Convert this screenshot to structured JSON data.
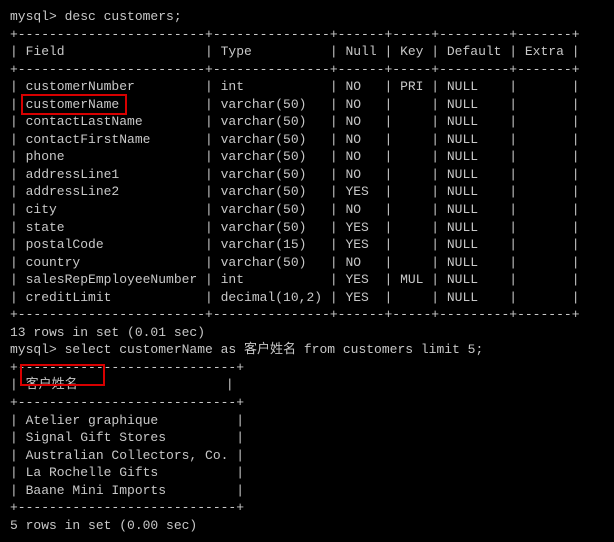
{
  "prompt1": "mysql> desc customers;",
  "tbl1": {
    "border_top": "+------------------------+---------------+------+-----+---------+-------+",
    "header": "| Field                  | Type          | Null | Key | Default | Extra |",
    "border_mid": "+------------------------+---------------+------+-----+---------+-------+",
    "rows": [
      "| customerNumber         | int           | NO   | PRI | NULL    |       |",
      "| customerName           | varchar(50)   | NO   |     | NULL    |       |",
      "| contactLastName        | varchar(50)   | NO   |     | NULL    |       |",
      "| contactFirstName       | varchar(50)   | NO   |     | NULL    |       |",
      "| phone                  | varchar(50)   | NO   |     | NULL    |       |",
      "| addressLine1           | varchar(50)   | NO   |     | NULL    |       |",
      "| addressLine2           | varchar(50)   | YES  |     | NULL    |       |",
      "| city                   | varchar(50)   | NO   |     | NULL    |       |",
      "| state                  | varchar(50)   | YES  |     | NULL    |       |",
      "| postalCode             | varchar(15)   | YES  |     | NULL    |       |",
      "| country                | varchar(50)   | NO   |     | NULL    |       |",
      "| salesRepEmployeeNumber | int           | YES  | MUL | NULL    |       |",
      "| creditLimit            | decimal(10,2) | YES  |     | NULL    |       |"
    ],
    "border_bot": "+------------------------+---------------+------+-----+---------+-------+"
  },
  "status1": "13 rows in set (0.01 sec)",
  "blank": "",
  "prompt2": "mysql> select customerName as 客户姓名 from customers limit 5;",
  "tbl2": {
    "border_top": "+----------------------------+",
    "header": "| 客户姓名                   |",
    "border_mid": "+----------------------------+",
    "rows": [
      "| Atelier graphique          |",
      "| Signal Gift Stores         |",
      "| Australian Collectors, Co. |",
      "| La Rochelle Gifts          |",
      "| Baane Mini Imports         |"
    ],
    "border_bot": "+----------------------------+"
  },
  "status2": "5 rows in set (0.00 sec)",
  "chart_data": {
    "type": "table",
    "tables": [
      {
        "title": "desc customers",
        "columns": [
          "Field",
          "Type",
          "Null",
          "Key",
          "Default",
          "Extra"
        ],
        "rows": [
          [
            "customerNumber",
            "int",
            "NO",
            "PRI",
            "NULL",
            ""
          ],
          [
            "customerName",
            "varchar(50)",
            "NO",
            "",
            "NULL",
            ""
          ],
          [
            "contactLastName",
            "varchar(50)",
            "NO",
            "",
            "NULL",
            ""
          ],
          [
            "contactFirstName",
            "varchar(50)",
            "NO",
            "",
            "NULL",
            ""
          ],
          [
            "phone",
            "varchar(50)",
            "NO",
            "",
            "NULL",
            ""
          ],
          [
            "addressLine1",
            "varchar(50)",
            "NO",
            "",
            "NULL",
            ""
          ],
          [
            "addressLine2",
            "varchar(50)",
            "YES",
            "",
            "NULL",
            ""
          ],
          [
            "city",
            "varchar(50)",
            "NO",
            "",
            "NULL",
            ""
          ],
          [
            "state",
            "varchar(50)",
            "YES",
            "",
            "NULL",
            ""
          ],
          [
            "postalCode",
            "varchar(15)",
            "YES",
            "",
            "NULL",
            ""
          ],
          [
            "country",
            "varchar(50)",
            "NO",
            "",
            "NULL",
            ""
          ],
          [
            "salesRepEmployeeNumber",
            "int",
            "YES",
            "MUL",
            "NULL",
            ""
          ],
          [
            "creditLimit",
            "decimal(10,2)",
            "YES",
            "",
            "NULL",
            ""
          ]
        ]
      },
      {
        "title": "select customerName as 客户姓名 from customers limit 5",
        "columns": [
          "客户姓名"
        ],
        "rows": [
          [
            "Atelier graphique"
          ],
          [
            "Signal Gift Stores"
          ],
          [
            "Australian Collectors, Co."
          ],
          [
            "La Rochelle Gifts"
          ],
          [
            "Baane Mini Imports"
          ]
        ]
      }
    ]
  }
}
